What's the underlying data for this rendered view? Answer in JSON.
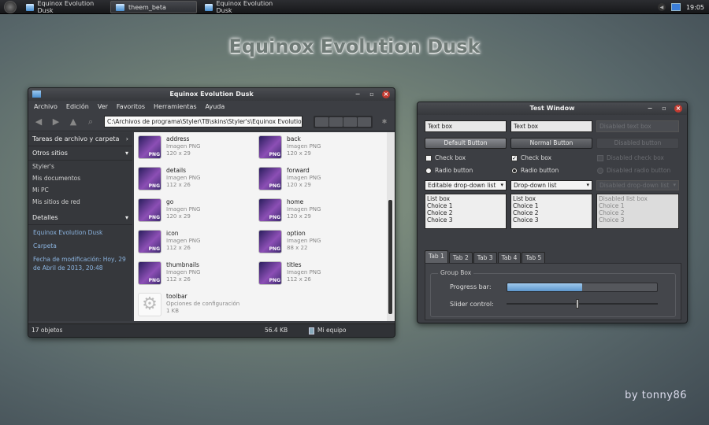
{
  "taskbar": {
    "items": [
      {
        "label": "Equinox Evolution Dusk"
      },
      {
        "label": "theem_beta"
      },
      {
        "label": "Equinox Evolution Dusk"
      }
    ],
    "clock": "19:05"
  },
  "heading": "Equinox Evolution Dusk",
  "credit": "by tonny86",
  "explorer": {
    "title": "Equinox Evolution Dusk",
    "menu": [
      "Archivo",
      "Edición",
      "Ver",
      "Favoritos",
      "Herramientas",
      "Ayuda"
    ],
    "address": "C:\\Archivos de programa\\Styler\\TB\\skins\\Styler's\\Equinox Evolution Dusk",
    "sidebar": {
      "tasks": "Tareas de archivo y carpeta",
      "other": "Otros sitios",
      "places": [
        "Styler's",
        "Mis documentos",
        "Mi PC",
        "Mis sitios de red"
      ],
      "details": "Detalles",
      "detail_name": "Equinox Evolution Dusk",
      "detail_type": "Carpeta",
      "detail_date": "Fecha de modificación: Hoy, 29 de Abril de 2013, 20:48"
    },
    "files": [
      {
        "name": "address",
        "type": "Imagen PNG",
        "size": "120 x 29"
      },
      {
        "name": "back",
        "type": "Imagen PNG",
        "size": "120 x 29"
      },
      {
        "name": "details",
        "type": "Imagen PNG",
        "size": "112 x 26"
      },
      {
        "name": "forward",
        "type": "Imagen PNG",
        "size": "120 x 29"
      },
      {
        "name": "go",
        "type": "Imagen PNG",
        "size": "120 x 29"
      },
      {
        "name": "home",
        "type": "Imagen PNG",
        "size": "120 x 29"
      },
      {
        "name": "icon",
        "type": "Imagen PNG",
        "size": "112 x 26"
      },
      {
        "name": "option",
        "type": "Imagen PNG",
        "size": "88 x 22"
      },
      {
        "name": "thumbnails",
        "type": "Imagen PNG",
        "size": "112 x 26"
      },
      {
        "name": "titles",
        "type": "Imagen PNG",
        "size": "112 x 26"
      },
      {
        "name": "toolbar",
        "type": "Opciones de configuración",
        "size": "1 KB"
      }
    ],
    "status": {
      "count": "17 objetos",
      "size": "56.4 KB",
      "location": "Mi equipo"
    }
  },
  "test": {
    "title": "Test Window",
    "textbox": "Text box",
    "textbox_disabled": "Disabled text box",
    "default_button": "Default Button",
    "normal_button": "Normal Button",
    "disabled_button": "Disabled button",
    "checkbox": "Check box",
    "checkbox_disabled": "Disabled check box",
    "radio": "Radio button",
    "radio_disabled": "Disabled radio button",
    "dd_editable": "Editable drop-down list",
    "dd": "Drop-down list",
    "dd_disabled": "Disabled drop-down list",
    "listbox": "List box",
    "listbox_disabled": "Disabled list box",
    "choices": [
      "Choice 1",
      "Choice 2",
      "Choice 3"
    ],
    "tabs": [
      "Tab 1",
      "Tab 2",
      "Tab 3",
      "Tab 4",
      "Tab 5"
    ],
    "group": "Group Box",
    "progress_label": "Progress bar:",
    "slider_label": "Slider control:",
    "progress": 0.5,
    "slider": 0.46
  }
}
